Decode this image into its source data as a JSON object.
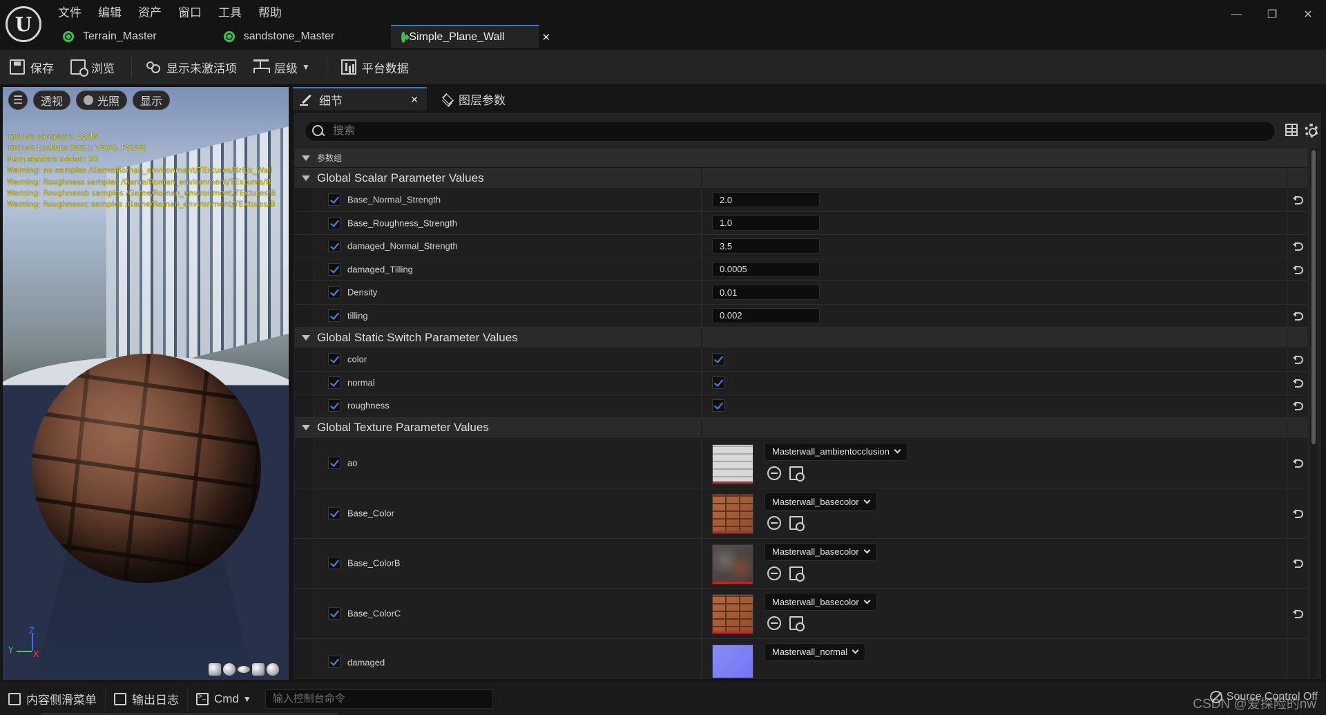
{
  "menu": [
    "文件",
    "编辑",
    "资产",
    "窗口",
    "工具",
    "帮助"
  ],
  "doc_tabs": [
    {
      "label": "Terrain_Master",
      "active": false
    },
    {
      "label": "sandstone_Master",
      "active": false
    },
    {
      "label": "Simple_Plane_Wall",
      "active": true
    }
  ],
  "window_controls": {
    "minimize": "—",
    "restore": "❐",
    "close": "✕"
  },
  "toolbar": {
    "save": "保存",
    "browse": "浏览",
    "show_inactive": "显示未激活项",
    "hierarchy": "层级",
    "platform_data": "平台数据"
  },
  "viewport": {
    "buttons": {
      "menu": "☰",
      "perspective": "透视",
      "lighting": "光照",
      "show": "显示"
    },
    "stats": [
      "Texture samplers: 13/16",
      "Texture Lookups (Est.): VS(0), PS(36)",
      "Num shaders added: 20",
      "Warning: ao samples /Game/Roman_environment/TExtures/Brick_Wall",
      "Warning: Roughness samples /Game/Roman_environment/TExtures/B",
      "Warning: Roughnessb samples /Game/Roman_environment/TExtures/B",
      "Warning: Roughnessc samples /Game/Roman_environment/TExtures/B"
    ],
    "axis": {
      "z": "Z",
      "y": "Y",
      "x": "X"
    }
  },
  "panel": {
    "details_tab": "细节",
    "layer_params_tab": "图层参数",
    "search_placeholder": "搜索",
    "group_header": "参数组"
  },
  "scalar_section": {
    "title": "Global Scalar Parameter Values",
    "rows": [
      {
        "name": "Base_Normal_Strength",
        "value": "2.0",
        "reset": true
      },
      {
        "name": "Base_Roughness_Strength",
        "value": "1.0",
        "reset": false
      },
      {
        "name": "damaged_Normal_Strength",
        "value": "3.5",
        "reset": true
      },
      {
        "name": "damaged_Tilling",
        "value": "0.0005",
        "reset": true
      },
      {
        "name": "Density",
        "value": "0.01",
        "reset": false
      },
      {
        "name": "tilling",
        "value": "0.002",
        "reset": true
      }
    ]
  },
  "switch_section": {
    "title": "Global Static Switch Parameter Values",
    "rows": [
      {
        "name": "color",
        "checked": true
      },
      {
        "name": "normal",
        "checked": true
      },
      {
        "name": "roughness",
        "checked": true
      }
    ]
  },
  "texture_section": {
    "title": "Global Texture Parameter Values",
    "rows": [
      {
        "name": "ao",
        "asset": "Masterwall_ambientocclusion",
        "thumb": "ao"
      },
      {
        "name": "Base_Color",
        "asset": "Masterwall_basecolor",
        "thumb": "base"
      },
      {
        "name": "Base_ColorB",
        "asset": "Masterwall_basecolor",
        "thumb": "baseb"
      },
      {
        "name": "Base_ColorC",
        "asset": "Masterwall_basecolor",
        "thumb": "base"
      },
      {
        "name": "damaged",
        "asset": "Masterwall_normal",
        "thumb": "normal"
      }
    ]
  },
  "statusbar": {
    "content_drawer": "内容侧滑菜单",
    "output_log": "输出日志",
    "cmd": "Cmd",
    "console_placeholder": "输入控制台命令",
    "source_control": "Source Control Off",
    "watermark": "CSDN @爱探险的nw"
  },
  "colors": {
    "accent": "#2e7bd6",
    "checkbox": "#3b8eea",
    "material_icon": "#3fbf4f"
  }
}
